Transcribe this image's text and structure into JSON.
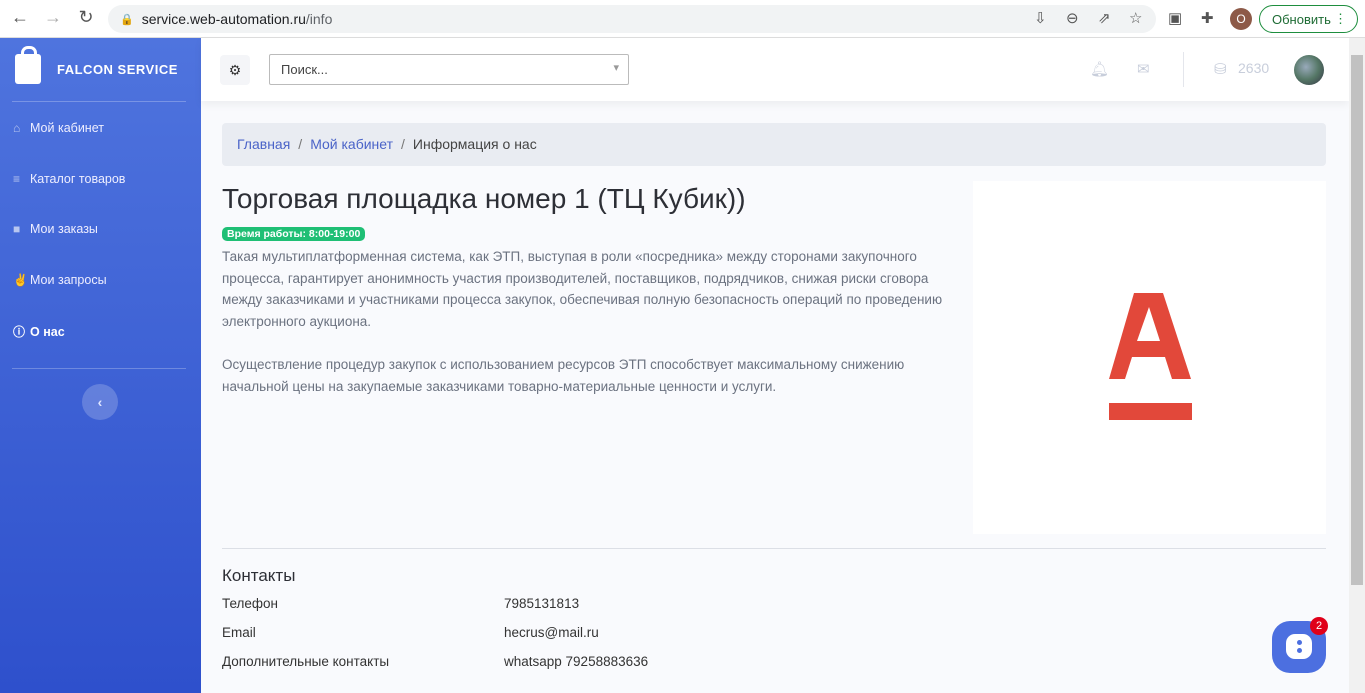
{
  "browser": {
    "url_host": "service.web-automation.ru",
    "url_path": "/info",
    "profile_initial": "O",
    "update_label": "Обновить"
  },
  "brand": "FALCON SERVICE",
  "sidebar": {
    "items": [
      {
        "label": "Мой кабинет",
        "icon": "home-icon"
      },
      {
        "label": "Каталог товаров",
        "icon": "list-icon"
      },
      {
        "label": "Мои заказы",
        "icon": "bag-icon"
      },
      {
        "label": "Мои запросы",
        "icon": "hand-icon"
      },
      {
        "label": "О нас",
        "icon": "info-icon",
        "active": true
      }
    ]
  },
  "topbar": {
    "search_placeholder": "Поиск...",
    "coins": "2630"
  },
  "breadcrumb": {
    "home": "Главная",
    "cabinet": "Мой кабинет",
    "current": "Информация о нас",
    "separator": "/"
  },
  "page": {
    "title": "Торговая площадка номер 1 (ТЦ Кубик))",
    "hours_badge": "Время работы: 8:00-19:00",
    "paragraph1": "Такая мультиплатформенная система, как ЭТП, выступая в роли «посредника» между сторонами закупочного процесса, гарантирует анонимность участия производителей, поставщиков, подрядчиков, снижая риски сговора между заказчиками и участниками процесса закупок, обеспечивая полную безопасность операций по проведению электронного аукциона.",
    "paragraph2": "Осуществление процедур закупок с использованием ресурсов ЭТП способствует максимальному снижению начальной цены на закупаемые заказчиками товарно-материальные ценности и услуги.",
    "logo_color": "#e2483a"
  },
  "contacts": {
    "heading": "Контакты",
    "rows": [
      {
        "label": "Телефон",
        "value": "7985131813"
      },
      {
        "label": "Email",
        "value": "hecrus@mail.ru"
      },
      {
        "label": "Дополнительные контакты",
        "value": "whatsapp 79258883636"
      }
    ]
  },
  "chat": {
    "unread": "2"
  }
}
